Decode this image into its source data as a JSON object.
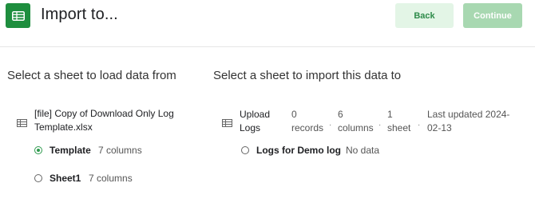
{
  "header": {
    "title": "Import to...",
    "icon": "spreadsheet-icon",
    "back_label": "Back",
    "continue_label": "Continue",
    "colors": {
      "brand": "#1e8e3e",
      "back_bg": "#e3f5e6",
      "back_text": "#2e8b4a",
      "continue_bg": "#a8d8b1"
    }
  },
  "left": {
    "title": "Select a sheet to load data from",
    "file_icon": "table-icon",
    "file_name": "[file] Copy of Download Only Log Template.xlsx",
    "sheets": [
      {
        "name": "Template",
        "meta": "7 columns",
        "selected": true
      },
      {
        "name": "Sheet1",
        "meta": "7 columns",
        "selected": false
      }
    ]
  },
  "right": {
    "title": "Select a sheet to import this data to",
    "file_icon": "table-icon",
    "file_name": "Upload Logs",
    "records": "0 records",
    "columns": "6 columns",
    "sheets_count": "1 sheet",
    "last_updated": "Last updated 2024-02-13",
    "targets": [
      {
        "name": "Logs for Demo log",
        "meta": "No data",
        "selected": false
      }
    ]
  }
}
